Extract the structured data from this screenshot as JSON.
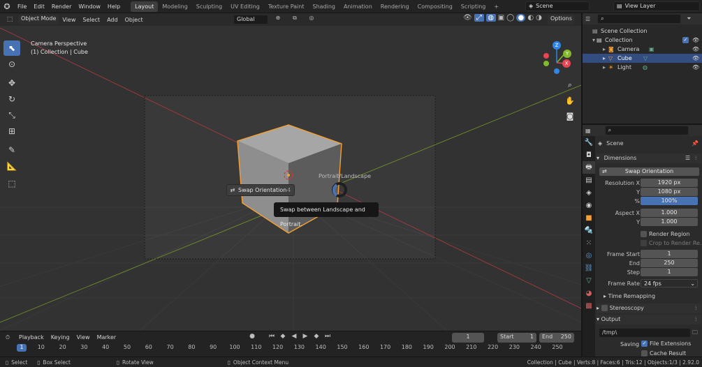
{
  "topbar": {
    "menus": [
      "File",
      "Edit",
      "Render",
      "Window",
      "Help"
    ],
    "workspaces": [
      "Layout",
      "Modeling",
      "Sculpting",
      "UV Editing",
      "Texture Paint",
      "Shading",
      "Animation",
      "Rendering",
      "Compositing",
      "Scripting"
    ],
    "add_tab": "+",
    "scene": "Scene",
    "view_layer": "View Layer"
  },
  "viewport_header": {
    "mode": "Object Mode",
    "menus": [
      "View",
      "Select",
      "Add",
      "Object"
    ],
    "transform": "Global",
    "options": "Options"
  },
  "viewport": {
    "title": "Camera Perspective",
    "subtitle": "(1) Collection | Cube",
    "gizmo_labels": {
      "x": "X",
      "y": "Y",
      "z": "Z"
    },
    "popup_label": "Portrait/Landscape",
    "operator_button": "Swap Orientation",
    "operator_shortcut": "4",
    "tooltip": "Swap between Landscape and Portrait."
  },
  "outliner": {
    "root": "Scene Collection",
    "collection": "Collection",
    "items": [
      "Camera",
      "Cube",
      "Light"
    ]
  },
  "properties": {
    "context": "Scene",
    "panel": "Dimensions",
    "swap_button": "Swap Orientation",
    "resolution_x_label": "Resolution X",
    "resolution_x": "1920 px",
    "resolution_y_label": "Y",
    "resolution_y": "1080 px",
    "percent_label": "%",
    "percent": "100%",
    "aspect_x_label": "Aspect X",
    "aspect_x": "1.000",
    "aspect_y_label": "Y",
    "aspect_y": "1.000",
    "render_region": "Render Region",
    "crop_region": "Crop to Render Re...",
    "frame_start_label": "Frame Start",
    "frame_start": "1",
    "end_label": "End",
    "end": "250",
    "step_label": "Step",
    "step": "1",
    "frame_rate_label": "Frame Rate",
    "frame_rate": "24 fps",
    "time_remapping": "Time Remapping",
    "stereoscopy": "Stereoscopy",
    "output": "Output",
    "output_path": "/tmp\\",
    "saving_label": "Saving",
    "file_extensions": "File Extensions",
    "cache_result": "Cache Result"
  },
  "timeline": {
    "menus": [
      "Playback",
      "Keying",
      "View",
      "Marker"
    ],
    "current_frame": "1",
    "start_label": "Start",
    "start": "1",
    "end_label": "End",
    "end": "250",
    "ruler": [
      "1",
      "10",
      "20",
      "30",
      "40",
      "50",
      "60",
      "70",
      "80",
      "90",
      "100",
      "110",
      "120",
      "130",
      "140",
      "150",
      "160",
      "170",
      "180",
      "190",
      "200",
      "210",
      "220",
      "230",
      "240",
      "250"
    ]
  },
  "statusbar": {
    "select": "Select",
    "box_select": "Box Select",
    "rotate_view": "Rotate View",
    "context_menu": "Object Context Menu",
    "stats": "Collection | Cube | Verts:8 | Faces:6 | Tris:12 | Objects:1/3 | 2.92.0"
  },
  "colors": {
    "accent": "#4772b3",
    "selection": "#f5a031",
    "x_axis": "#e84452",
    "y_axis": "#83b92a",
    "z_axis": "#2f86e8"
  }
}
